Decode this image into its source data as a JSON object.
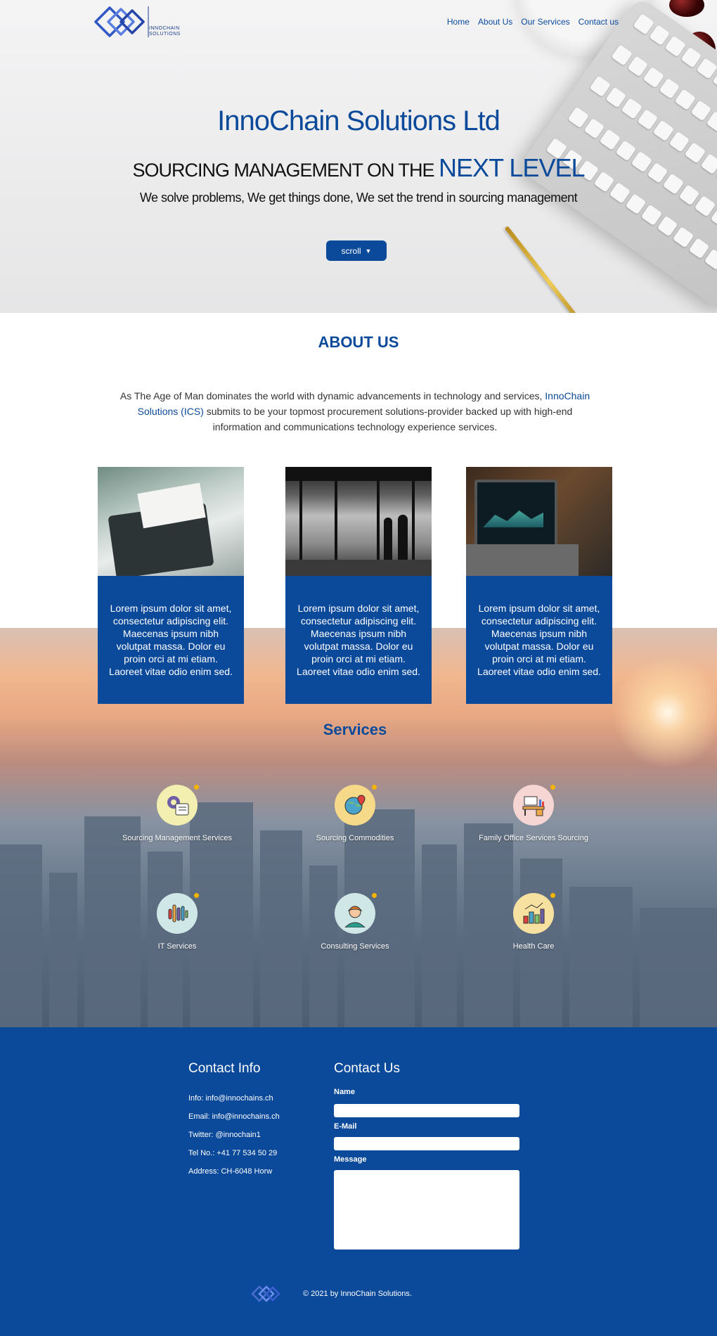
{
  "header": {
    "logo_text_line1": "INNOCHAIN",
    "logo_text_line2": "SOLUTIONS",
    "nav": [
      "Home",
      "About Us",
      "Our Services",
      "Contact us"
    ]
  },
  "hero": {
    "title": "InnoChain Solutions Ltd",
    "subtitle_prefix": "SOURCING MANAGEMENT ON THE ",
    "subtitle_accent": "NEXT LEVEL",
    "tagline": "We solve problems,  We get things done,  We set the trend in sourcing management",
    "scroll_label": "scroll",
    "scroll_icon": "▼"
  },
  "about": {
    "title": "ABOUT US",
    "text_before": "As The Age of Man dominates the world with dynamic advancements in technology and services, ",
    "text_highlight": "InnoChain Solutions (ICS)",
    "text_after": " submits to be your topmost procurement solutions-provider backed up with high-end information and communications technology experience services."
  },
  "cards": [
    {
      "text": "Lorem ipsum dolor sit amet, consectetur adipiscing elit. Maecenas ipsum nibh volutpat massa. Dolor eu proin orci at mi etiam. Laoreet vitae odio enim sed.",
      "image": "laptop-meeting-photo"
    },
    {
      "text": "Lorem ipsum dolor sit amet, consectetur adipiscing elit. Maecenas ipsum nibh volutpat massa. Dolor eu proin orci at mi etiam. Laoreet vitae odio enim sed.",
      "image": "city-window-silhouettes-photo"
    },
    {
      "text": "Lorem ipsum dolor sit amet, consectetur adipiscing elit. Maecenas ipsum nibh volutpat massa. Dolor eu proin orci at mi etiam. Laoreet vitae odio enim sed.",
      "image": "laptop-dashboard-photo"
    }
  ],
  "services": {
    "title": "Services",
    "items": [
      {
        "label": "Sourcing Management Services",
        "icon": "gear-document-icon",
        "bg": "#f2efb0"
      },
      {
        "label": "Sourcing Commodities",
        "icon": "globe-pin-icon",
        "bg": "#f7d98a"
      },
      {
        "label": "Family Office Services Sourcing",
        "icon": "desk-computer-icon",
        "bg": "#f6d6d3"
      },
      {
        "label": "IT Services",
        "icon": "equalizer-icon",
        "bg": "#cfe7e6"
      },
      {
        "label": "Consulting Services",
        "icon": "consultant-avatar-icon",
        "bg": "#cfe7e6"
      },
      {
        "label": "Health Care",
        "icon": "bar-chart-icon",
        "bg": "#f7e1a0"
      }
    ]
  },
  "footer": {
    "contact_info_title": "Contact Info",
    "info_lines": [
      "Info: info@innochains.ch",
      "Email: info@innochains.ch",
      "Twitter: @innochain1",
      "Tel No.: +41 77 534 50 29",
      "Address: CH-6048 Horw"
    ],
    "contact_us_title": "Contact Us",
    "form": {
      "name_label": "Name",
      "email_label": "E-Mail",
      "message_label": "Message"
    },
    "copyright": "© 2021 by InnoChain Solutions."
  },
  "colors": {
    "brand_blue": "#0b4a9a",
    "white": "#ffffff"
  }
}
